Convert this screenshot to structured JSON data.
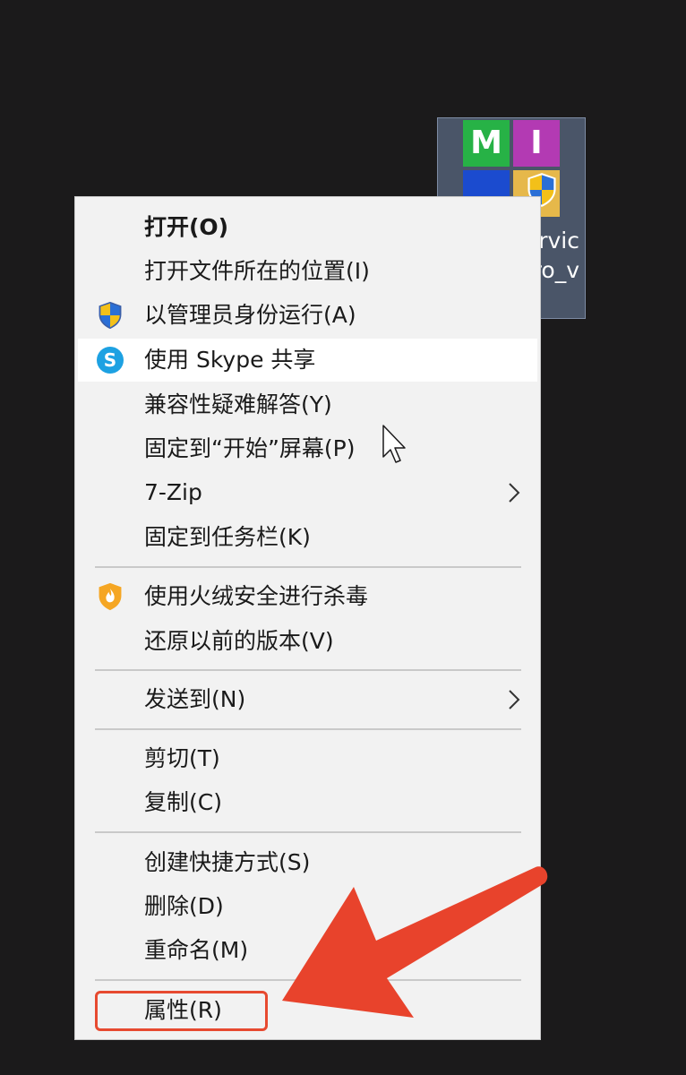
{
  "desktop_icon": {
    "tile_letters": [
      "M",
      "I"
    ],
    "caption_lines": [
      "rvic",
      "ro_v"
    ]
  },
  "context_menu": {
    "items": [
      {
        "label": "打开(O)",
        "icon": "",
        "bold": true,
        "submenu": false
      },
      {
        "label": "打开文件所在的位置(I)",
        "icon": "",
        "bold": false,
        "submenu": false
      },
      {
        "label": "以管理员身份运行(A)",
        "icon": "uac-shield-icon",
        "bold": false,
        "submenu": false
      },
      {
        "label": "使用 Skype 共享",
        "icon": "skype-icon",
        "bold": false,
        "submenu": false,
        "highlighted": true
      },
      {
        "label": "兼容性疑难解答(Y)",
        "icon": "",
        "bold": false,
        "submenu": false
      },
      {
        "label": "固定到“开始”屏幕(P)",
        "icon": "",
        "bold": false,
        "submenu": false
      },
      {
        "label": "7-Zip",
        "icon": "",
        "bold": false,
        "submenu": true
      },
      {
        "label": "固定到任务栏(K)",
        "icon": "",
        "bold": false,
        "submenu": false
      },
      {
        "label": "使用火绒安全进行杀毒",
        "icon": "huorong-icon",
        "bold": false,
        "submenu": false
      },
      {
        "label": "还原以前的版本(V)",
        "icon": "",
        "bold": false,
        "submenu": false
      },
      {
        "label": "发送到(N)",
        "icon": "",
        "bold": false,
        "submenu": true
      },
      {
        "label": "剪切(T)",
        "icon": "",
        "bold": false,
        "submenu": false
      },
      {
        "label": "复制(C)",
        "icon": "",
        "bold": false,
        "submenu": false
      },
      {
        "label": "创建快捷方式(S)",
        "icon": "",
        "bold": false,
        "submenu": false
      },
      {
        "label": "删除(D)",
        "icon": "",
        "bold": false,
        "submenu": false
      },
      {
        "label": "重命名(M)",
        "icon": "",
        "bold": false,
        "submenu": false
      },
      {
        "label": "属性(R)",
        "icon": "",
        "bold": false,
        "submenu": false
      }
    ]
  },
  "annotation": {
    "highlight_color": "#e74a30",
    "arrow_color": "#e8432c",
    "target_item": "属性(R)"
  },
  "colors": {
    "desktop_background": "#1b1a1b",
    "menu_background": "#f2f2f2",
    "menu_hover": "#ffffff"
  }
}
